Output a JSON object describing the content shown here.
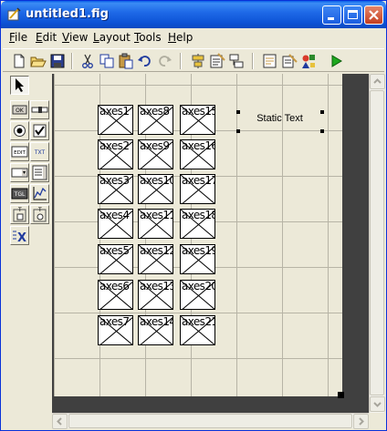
{
  "window": {
    "title": "untitled1.fig",
    "title_color": "#0a5fe8"
  },
  "menubar": {
    "items": [
      {
        "first": "F",
        "rest": "ile"
      },
      {
        "first": "E",
        "rest": "dit"
      },
      {
        "first": "V",
        "rest": "iew"
      },
      {
        "first": "L",
        "rest": "ayout"
      },
      {
        "first": "T",
        "rest": "ools"
      },
      {
        "first": "H",
        "rest": "elp"
      }
    ]
  },
  "toolbar": {
    "icons": [
      "new-file-icon",
      "open-folder-icon",
      "save-icon",
      "cut-icon",
      "copy-icon",
      "paste-icon",
      "undo-icon",
      "redo-icon",
      "align-objects-icon",
      "menu-editor-icon",
      "tab-order-editor-icon",
      "m-file-editor-icon",
      "property-inspector-icon",
      "object-browser-icon",
      "run-icon"
    ]
  },
  "palette": {
    "tools": [
      {
        "name": "select-tool-icon",
        "label": ""
      },
      {
        "name": "push-button-tool-icon",
        "label": "OK"
      },
      {
        "name": "slider-tool-icon",
        "label": ""
      },
      {
        "name": "radio-button-tool-icon",
        "label": ""
      },
      {
        "name": "checkbox-tool-icon",
        "label": ""
      },
      {
        "name": "edit-text-tool-icon",
        "label": "EDIT"
      },
      {
        "name": "static-text-tool-icon",
        "label": "TXT"
      },
      {
        "name": "popup-menu-tool-icon",
        "label": ""
      },
      {
        "name": "listbox-tool-icon",
        "label": ""
      },
      {
        "name": "toggle-button-tool-icon",
        "label": "TGL"
      },
      {
        "name": "axes-tool-icon",
        "label": ""
      },
      {
        "name": "panel-tool-icon",
        "label": ""
      },
      {
        "name": "button-group-tool-icon",
        "label": ""
      },
      {
        "name": "activex-control-tool-icon",
        "label": "X"
      }
    ]
  },
  "layout": {
    "axes": [
      [
        "axes1",
        "axes8",
        "axes15"
      ],
      [
        "axes2",
        "axes9",
        "axes16"
      ],
      [
        "axes3",
        "axes10",
        "axes17"
      ],
      [
        "axes4",
        "axes11",
        "axes18"
      ],
      [
        "axes5",
        "axes12",
        "axes19"
      ],
      [
        "axes6",
        "axes13",
        "axes20"
      ],
      [
        "axes7",
        "axes14",
        "axes21"
      ]
    ],
    "static_text": "Static Text"
  }
}
